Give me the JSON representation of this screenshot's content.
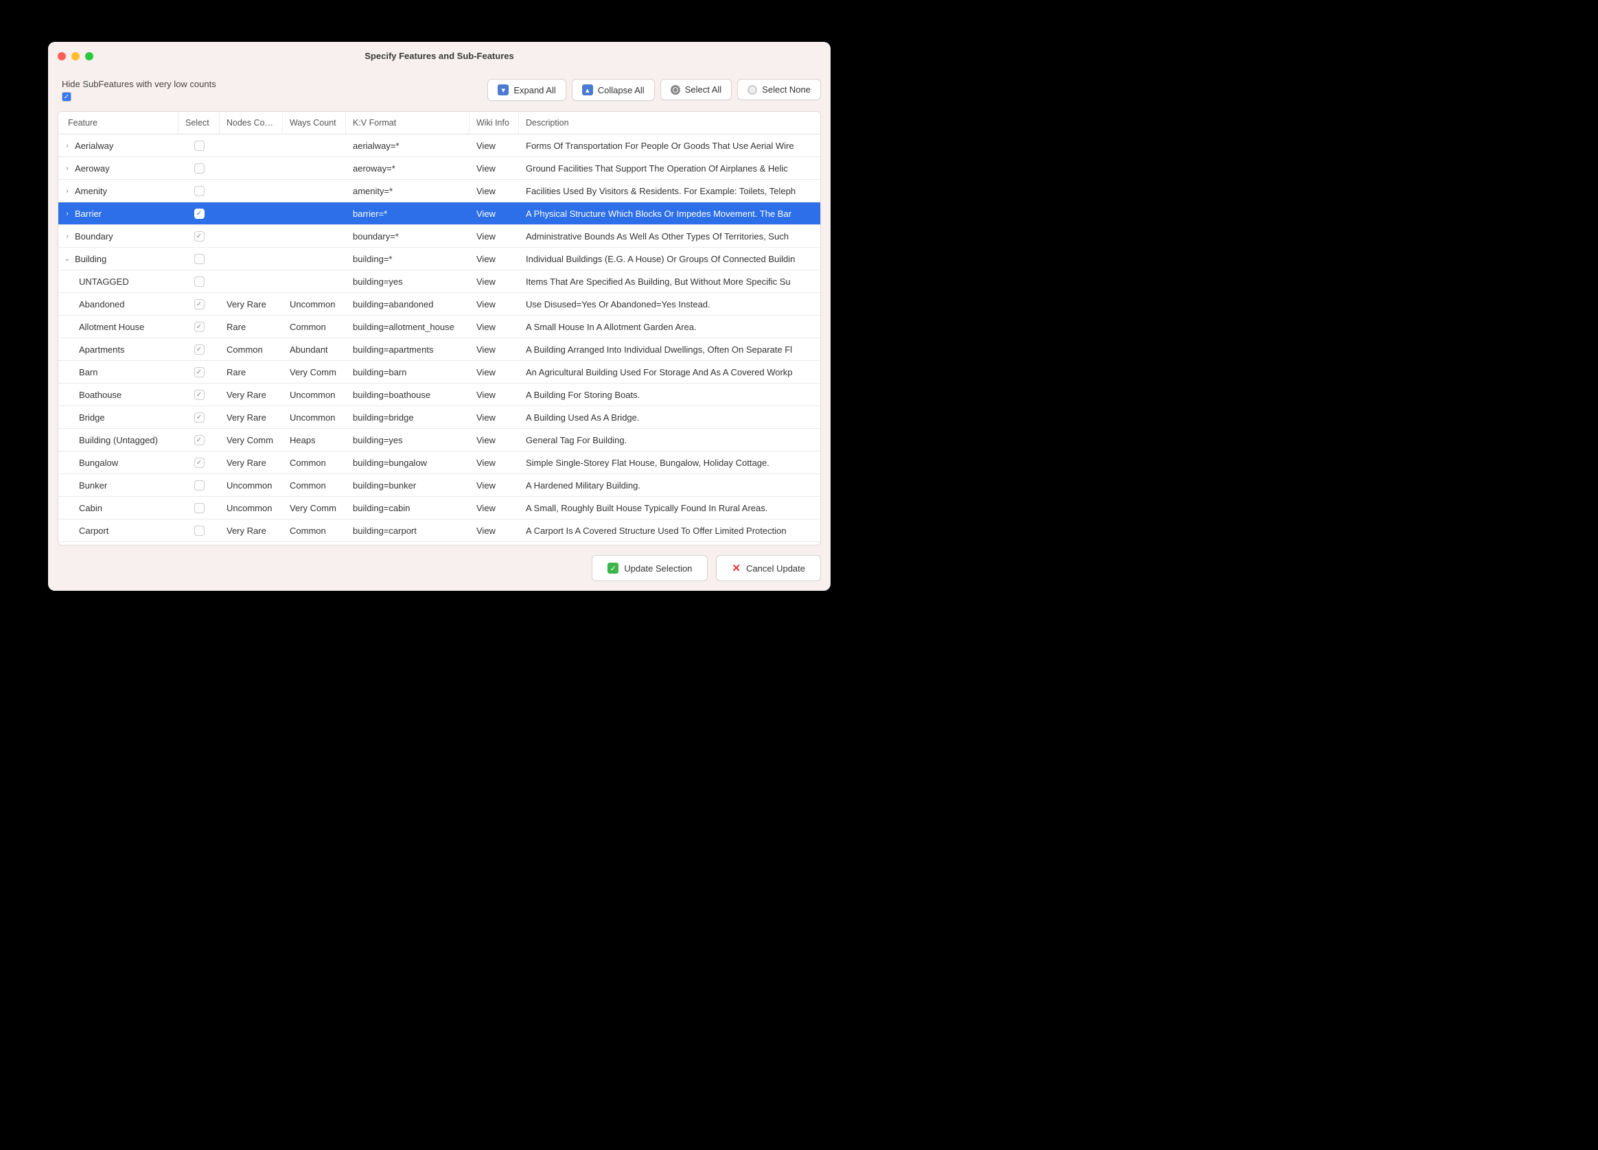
{
  "title": "Specify Features and Sub-Features",
  "hideSubFeatures": {
    "label": "Hide SubFeatures with very low counts",
    "checked": true
  },
  "toolbar": {
    "expandAll": "Expand All",
    "collapseAll": "Collapse All",
    "selectAll": "Select All",
    "selectNone": "Select None"
  },
  "columns": {
    "feature": "Feature",
    "select": "Select",
    "nodes": "Nodes Co…",
    "ways": "Ways Count",
    "kv": "K:V Format",
    "wiki": "Wiki Info",
    "desc": "Description"
  },
  "wikiLabel": "View",
  "rows": [
    {
      "type": "parent",
      "expanded": false,
      "name": "Aerialway",
      "checked": "none",
      "nodes": "",
      "ways": "",
      "kv": "aerialway=*",
      "desc": "Forms Of Transportation For People Or Goods That Use Aerial Wire"
    },
    {
      "type": "parent",
      "expanded": false,
      "name": "Aeroway",
      "checked": "none",
      "nodes": "",
      "ways": "",
      "kv": "aeroway=*",
      "desc": "Ground Facilities  That Support The Operation Of Airplanes & Helic"
    },
    {
      "type": "parent",
      "expanded": false,
      "name": "Amenity",
      "checked": "none",
      "nodes": "",
      "ways": "",
      "kv": "amenity=*",
      "desc": "Facilities Used By Visitors & Residents. For Example: Toilets, Teleph"
    },
    {
      "type": "parent",
      "expanded": false,
      "selected": true,
      "name": "Barrier",
      "checked": "blue",
      "nodes": "",
      "ways": "",
      "kv": "barrier=*",
      "desc": "A Physical Structure Which Blocks Or Impedes Movement. The Bar"
    },
    {
      "type": "parent",
      "expanded": false,
      "name": "Boundary",
      "checked": "gray",
      "nodes": "",
      "ways": "",
      "kv": "boundary=*",
      "desc": "Administrative Bounds As Well As Other Types Of Territories, Such"
    },
    {
      "type": "parent",
      "expanded": true,
      "name": "Building",
      "checked": "none",
      "nodes": "",
      "ways": "",
      "kv": "building=*",
      "desc": "Individual Buildings (E.G. A House) Or Groups Of Connected Buildin"
    },
    {
      "type": "child",
      "name": "UNTAGGED",
      "checked": "none",
      "nodes": "",
      "ways": "",
      "kv": "building=yes",
      "desc": "Items That Are Specified As Building, But Without More Specific Su"
    },
    {
      "type": "child",
      "name": "Abandoned",
      "checked": "gray",
      "nodes": "Very Rare",
      "ways": "Uncommon",
      "kv": "building=abandoned",
      "desc": "Use Disused=Yes Or Abandoned=Yes Instead."
    },
    {
      "type": "child",
      "name": "Allotment House",
      "checked": "gray",
      "nodes": "Rare",
      "ways": "Common",
      "kv": "building=allotment_house",
      "desc": "A Small House In A Allotment Garden Area."
    },
    {
      "type": "child",
      "name": "Apartments",
      "checked": "gray",
      "nodes": "Common",
      "ways": "Abundant",
      "kv": "building=apartments",
      "desc": "A Building Arranged Into Individual Dwellings, Often On Separate Fl"
    },
    {
      "type": "child",
      "name": "Barn",
      "checked": "gray",
      "nodes": "Rare",
      "ways": "Very Comm",
      "kv": "building=barn",
      "desc": "An Agricultural Building Used For Storage And As A Covered Workp"
    },
    {
      "type": "child",
      "name": "Boathouse",
      "checked": "gray",
      "nodes": "Very Rare",
      "ways": "Uncommon",
      "kv": "building=boathouse",
      "desc": "A Building For Storing Boats."
    },
    {
      "type": "child",
      "name": "Bridge",
      "checked": "gray",
      "nodes": "Very Rare",
      "ways": "Uncommon",
      "kv": "building=bridge",
      "desc": "A Building Used As A Bridge."
    },
    {
      "type": "child",
      "name": "Building (Untagged)",
      "checked": "gray",
      "nodes": "Very Comm",
      "ways": "Heaps",
      "kv": "building=yes",
      "desc": "General Tag For Building."
    },
    {
      "type": "child",
      "name": "Bungalow",
      "checked": "gray",
      "nodes": "Very Rare",
      "ways": "Common",
      "kv": "building=bungalow",
      "desc": "Simple Single-Storey Flat House, Bungalow, Holiday Cottage."
    },
    {
      "type": "child",
      "name": "Bunker",
      "checked": "none",
      "nodes": "Uncommon",
      "ways": "Common",
      "kv": "building=bunker",
      "desc": "A Hardened Military Building."
    },
    {
      "type": "child",
      "name": "Cabin",
      "checked": "none",
      "nodes": "Uncommon",
      "ways": "Very Comm",
      "kv": "building=cabin",
      "desc": "A Small, Roughly Built House Typically Found In Rural Areas."
    },
    {
      "type": "child",
      "name": "Carport",
      "checked": "none",
      "nodes": "Very Rare",
      "ways": "Common",
      "kv": "building=carport",
      "desc": "A Carport Is A Covered Structure Used To Offer Limited Protection"
    }
  ],
  "footer": {
    "update": "Update Selection",
    "cancel": "Cancel Update"
  }
}
